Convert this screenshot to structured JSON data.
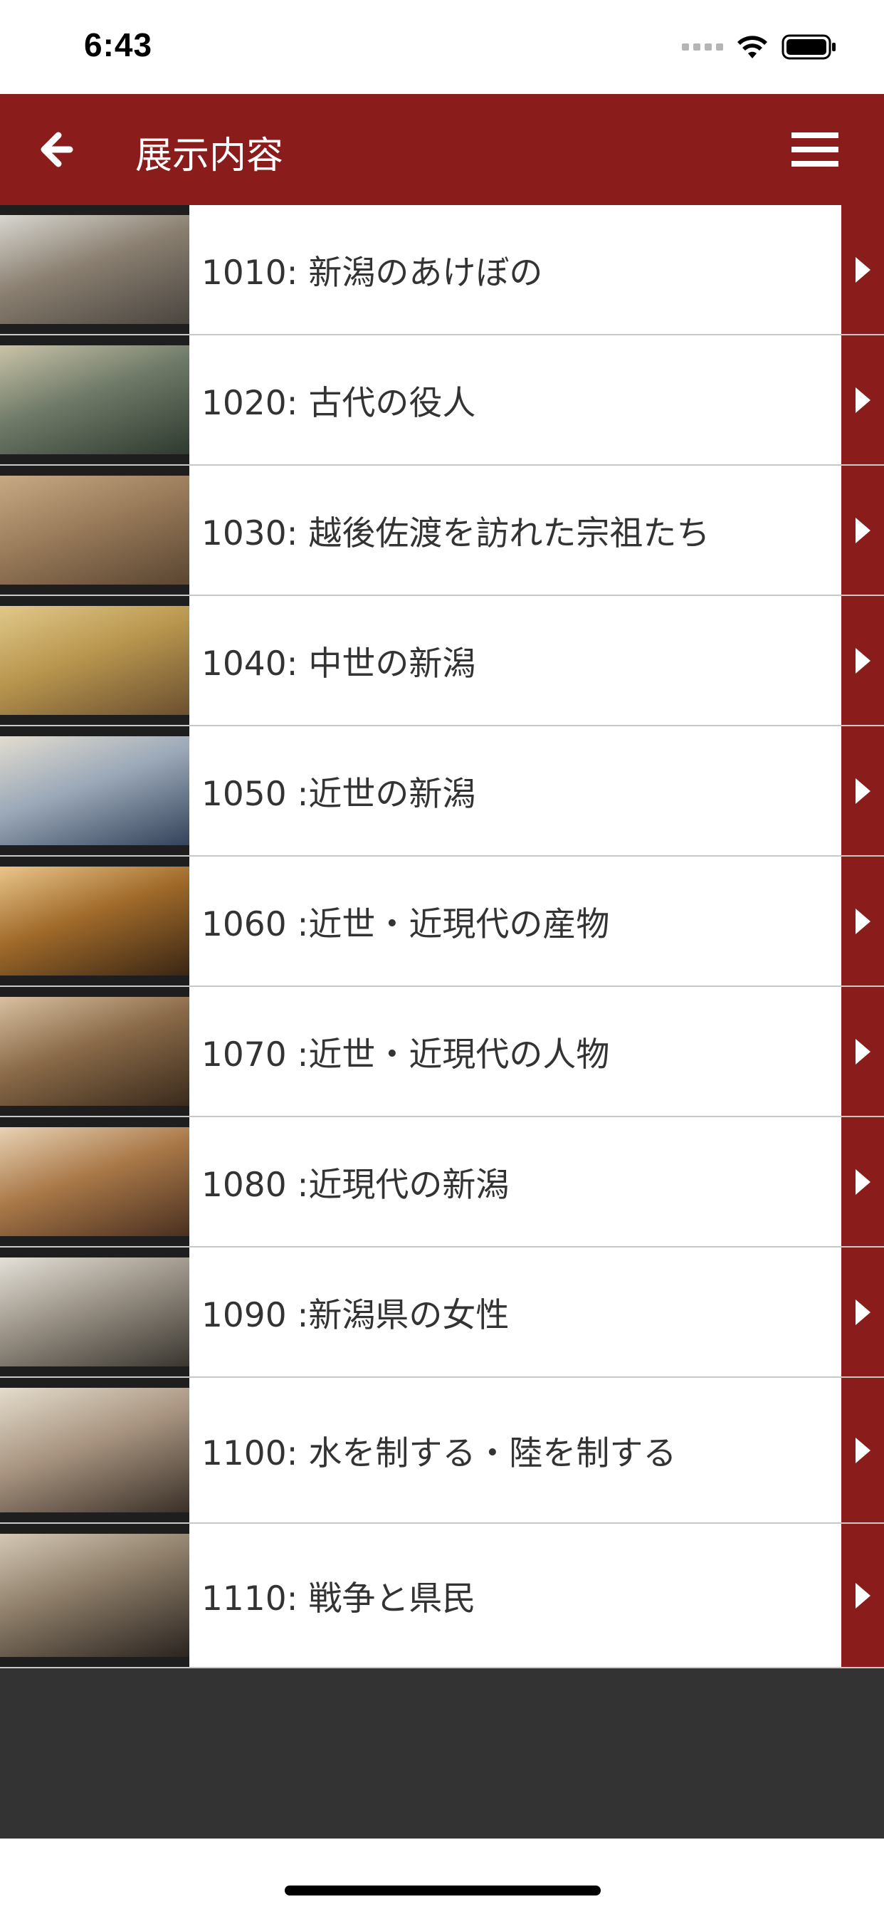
{
  "status_bar": {
    "time": "6:43"
  },
  "nav": {
    "title": "展示内容",
    "back_icon": "arrow-left-icon",
    "menu_icon": "hamburger-menu-icon"
  },
  "colors": {
    "accent": "#8b1c1c",
    "footer": "#333333"
  },
  "items": [
    {
      "label": "1010: 新潟のあけぼの",
      "thumb": [
        "#4a4540",
        "#8a7f70",
        "#d8d6d0"
      ]
    },
    {
      "label": "1020: 古代の役人",
      "thumb": [
        "#2f3a30",
        "#6f7a68",
        "#c9c3a8"
      ]
    },
    {
      "label": "1030: 越後佐渡を訪れた宗祖たち",
      "thumb": [
        "#5a4632",
        "#9a7b5a",
        "#c8a984"
      ]
    },
    {
      "label": "1040: 中世の新潟",
      "thumb": [
        "#6b5030",
        "#b9964e",
        "#e0c88a"
      ]
    },
    {
      "label": "1050 :近世の新潟",
      "thumb": [
        "#34435a",
        "#9aa8b8",
        "#e2dcd0"
      ]
    },
    {
      "label": "1060 :近世・近現代の産物",
      "thumb": [
        "#3a2614",
        "#a06a2a",
        "#e9c58a"
      ]
    },
    {
      "label": "1070 :近世・近現代の人物",
      "thumb": [
        "#3a2a1c",
        "#8a6a48",
        "#d8c0a0"
      ]
    },
    {
      "label": "1080 :近現代の新潟",
      "thumb": [
        "#4a3020",
        "#a97848",
        "#e8d2b4"
      ]
    },
    {
      "label": "1090 :新潟県の女性",
      "thumb": [
        "#3a3630",
        "#9a9286",
        "#e4e0d8"
      ]
    },
    {
      "label": "1100: 水を制する・陸を制する",
      "thumb": [
        "#3a3028",
        "#a89480",
        "#e4dccc"
      ]
    },
    {
      "label": "1110: 戦争と県民",
      "thumb": [
        "#2a2420",
        "#8a7a66",
        "#d4c8b4"
      ]
    }
  ]
}
